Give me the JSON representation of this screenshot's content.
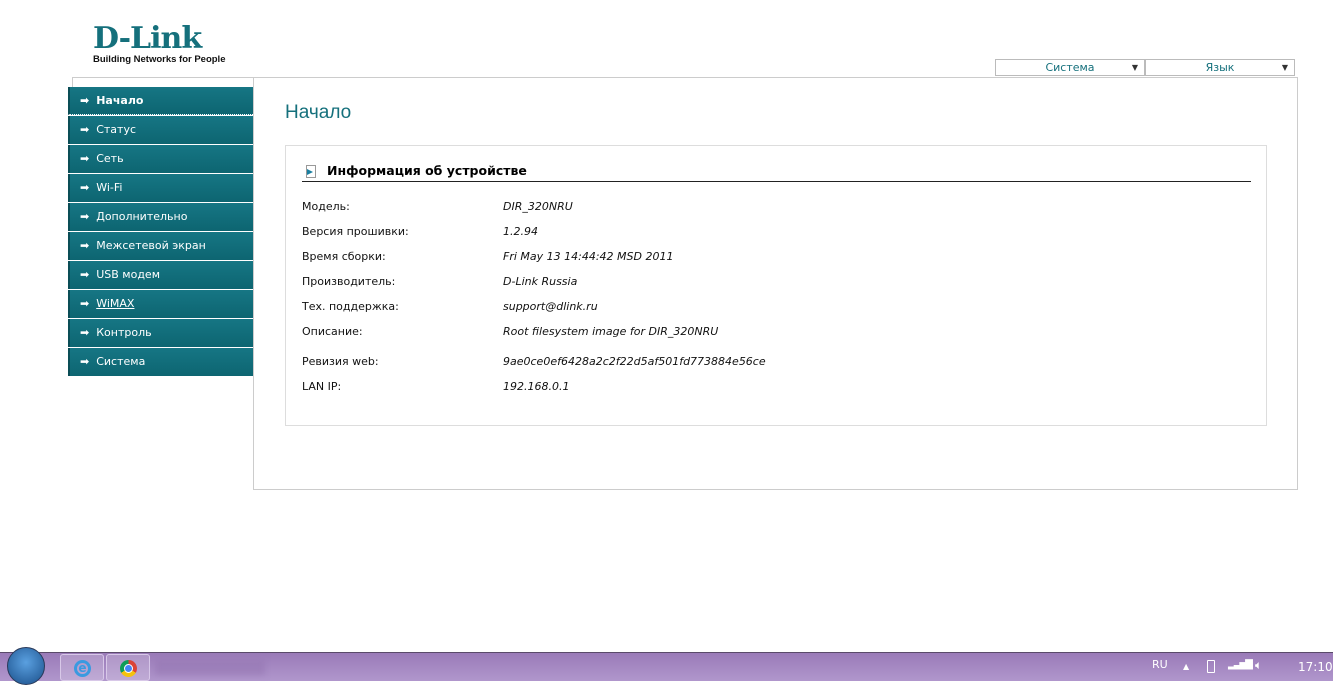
{
  "logo": {
    "brand": "D-Link",
    "tagline": "Building Networks for People"
  },
  "top_selects": [
    {
      "label": "Система"
    },
    {
      "label": "Язык"
    }
  ],
  "menu": [
    {
      "label": "Начало"
    },
    {
      "label": "Статус"
    },
    {
      "label": "Сеть"
    },
    {
      "label": "Wi-Fi"
    },
    {
      "label": "Дополнительно"
    },
    {
      "label": "Межсетевой экран"
    },
    {
      "label": "USB модем"
    },
    {
      "label": "WiMAX"
    },
    {
      "label": "Контроль"
    },
    {
      "label": "Система"
    }
  ],
  "page_title": "Начало",
  "device_info": {
    "heading": "Информация об устройстве",
    "rows": [
      {
        "label": "Модель:",
        "value": "DIR_320NRU"
      },
      {
        "label": "Версия прошивки:",
        "value": "1.2.94"
      },
      {
        "label": "Время сборки:",
        "value": "Fri May 13 14:44:42 MSD 2011"
      },
      {
        "label": "Производитель:",
        "value": "D-Link Russia"
      },
      {
        "label": "Тех. поддержка:",
        "value": "support@dlink.ru"
      },
      {
        "label": "Описание:",
        "value": "Root filesystem image for DIR_320NRU"
      },
      {
        "label": "Ревизия web:",
        "value": "9ae0ce0ef6428a2c2f22d5af501fd773884e56ce"
      },
      {
        "label": "LAN IP:",
        "value": "192.168.0.1"
      }
    ]
  },
  "taskbar": {
    "lang": "RU",
    "clock": "17:10"
  }
}
